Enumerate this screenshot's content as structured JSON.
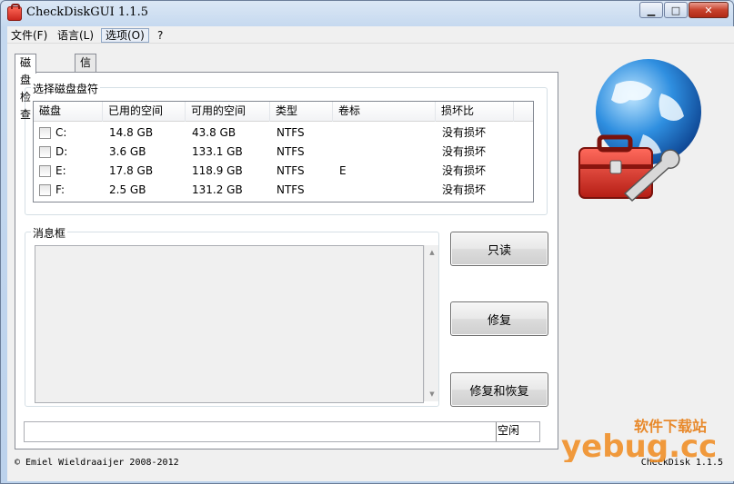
{
  "window": {
    "title": "CheckDiskGUI 1.1.5",
    "controls": {
      "minimize": "▁",
      "maximize": "□",
      "close": "✕"
    }
  },
  "menu": [
    {
      "label": "文件(F)"
    },
    {
      "label": "语言(L)"
    },
    {
      "label": "选项(O)"
    },
    {
      "label": "?"
    }
  ],
  "tabs": [
    {
      "label": "磁盘检查",
      "active": true
    },
    {
      "label": "信息",
      "active": false
    }
  ],
  "drive_group": {
    "title": "选择磁盘盘符",
    "columns": [
      "磁盘",
      "已用的空间",
      "可用的空间",
      "类型",
      "卷标",
      "损坏比"
    ],
    "rows": [
      {
        "drive": "C:",
        "used": "14.8 GB",
        "free": "43.8 GB",
        "type": "NTFS",
        "label": "",
        "damage": "没有损坏"
      },
      {
        "drive": "D:",
        "used": "3.6 GB",
        "free": "133.1 GB",
        "type": "NTFS",
        "label": "",
        "damage": "没有损坏"
      },
      {
        "drive": "E:",
        "used": "17.8 GB",
        "free": "118.9 GB",
        "type": "NTFS",
        "label": "E",
        "damage": "没有损坏"
      },
      {
        "drive": "F:",
        "used": "2.5 GB",
        "free": "131.2 GB",
        "type": "NTFS",
        "label": "",
        "damage": "没有损坏"
      }
    ]
  },
  "message_group": {
    "title": "消息框",
    "content": ""
  },
  "buttons": {
    "readonly": "只读",
    "repair": "修复",
    "repair_recover": "修复和恢复"
  },
  "status": {
    "text": "空闲"
  },
  "footer": {
    "copyright": "© Emiel Wieldraaijer 2008-2012",
    "version": "CheckDisk 1.1.5"
  },
  "watermark": {
    "text": "软件下载站",
    "brand": "yebug.cc"
  },
  "icons": {
    "app": "toolbox-icon",
    "logo": "globe-toolbox-icon"
  }
}
